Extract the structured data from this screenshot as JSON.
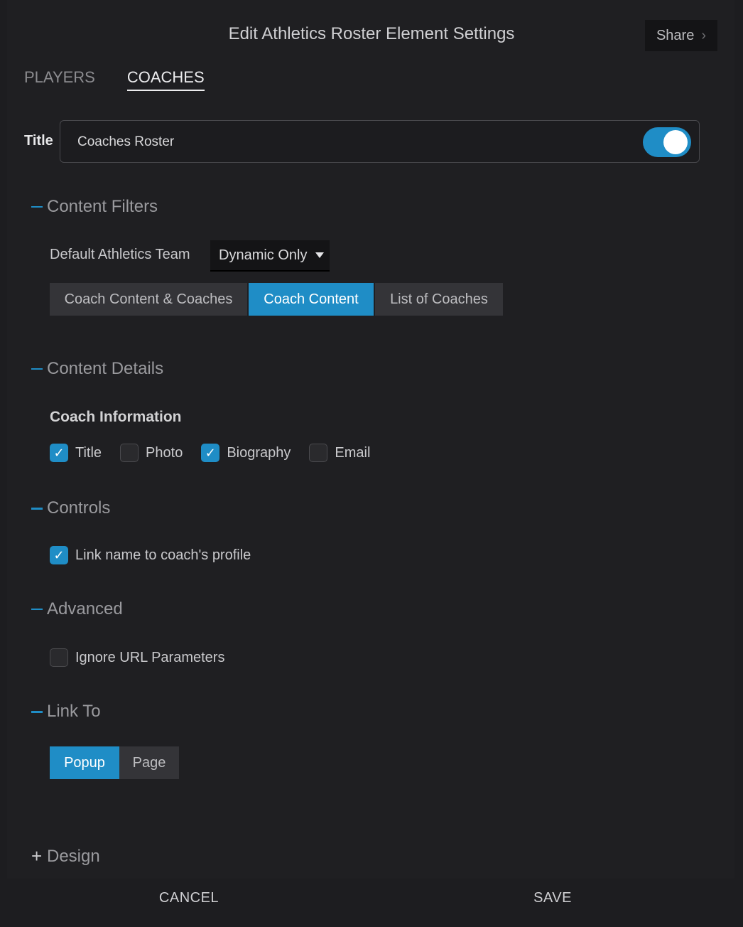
{
  "header": {
    "title": "Edit Athletics Roster Element Settings",
    "share_label": "Share"
  },
  "tabs": [
    {
      "label": "PLAYERS",
      "active": false
    },
    {
      "label": "COACHES",
      "active": true
    }
  ],
  "title_field": {
    "label": "Title",
    "value": "Coaches Roster",
    "toggle_on": true
  },
  "content_filters": {
    "heading": "Content Filters",
    "team_label": "Default Athletics Team",
    "team_value": "Dynamic Only",
    "display_options": [
      "Coach Content & Coaches",
      "Coach Content",
      "List of Coaches"
    ],
    "display_selected": "Coach Content"
  },
  "content_details": {
    "heading": "Content Details",
    "subheading": "Coach Information",
    "checkboxes": [
      {
        "label": "Title",
        "checked": true
      },
      {
        "label": "Photo",
        "checked": false
      },
      {
        "label": "Biography",
        "checked": true
      },
      {
        "label": "Email",
        "checked": false
      }
    ]
  },
  "controls": {
    "heading": "Controls",
    "link_name_label": "Link name to coach's profile",
    "link_name_checked": true
  },
  "advanced": {
    "heading": "Advanced",
    "ignore_url_label": "Ignore URL Parameters",
    "ignore_url_checked": false
  },
  "link_to": {
    "heading": "Link To",
    "options": [
      "Popup",
      "Page"
    ],
    "selected": "Popup"
  },
  "design": {
    "heading": "Design"
  },
  "footer": {
    "cancel_label": "CANCEL",
    "save_label": "SAVE"
  },
  "colors": {
    "accent": "#1f8dc6",
    "background": "#1f1f22"
  }
}
